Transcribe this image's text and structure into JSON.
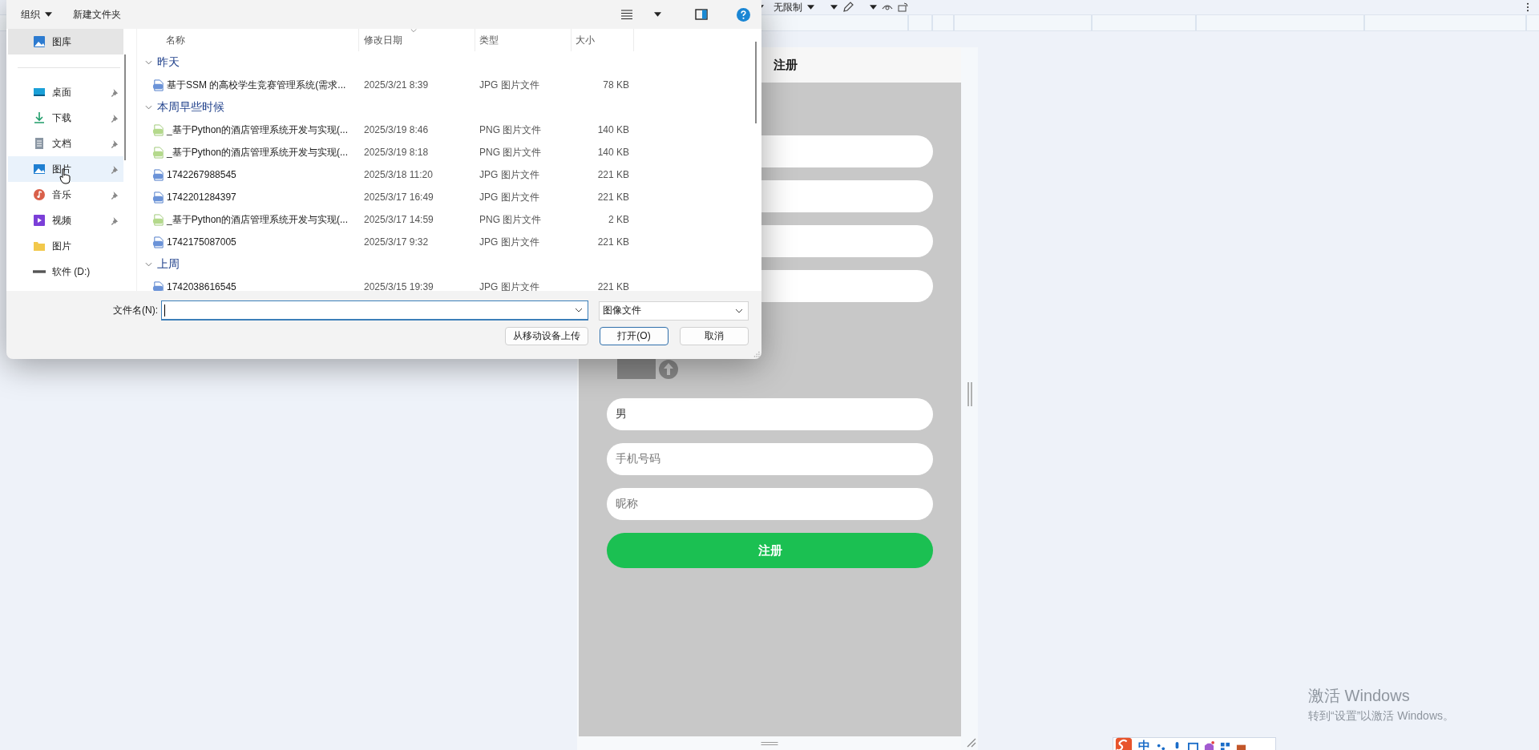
{
  "toolbar": {
    "zoom_label": "无限制"
  },
  "phone": {
    "title": "注册",
    "fields": [
      {
        "kind": "input"
      },
      {
        "kind": "input"
      },
      {
        "kind": "input"
      },
      {
        "kind": "input"
      },
      {
        "kind": "upload"
      },
      {
        "kind": "input",
        "value": "男"
      },
      {
        "kind": "input",
        "placeholder": "手机号码"
      },
      {
        "kind": "input",
        "placeholder": "昵称"
      }
    ],
    "submit_button": "注册"
  },
  "dialog": {
    "toolbar": {
      "organize": "组织",
      "new_folder": "新建文件夹"
    },
    "sidebar": [
      {
        "kind": "gallery",
        "label": "图库",
        "pinned": false,
        "selected": true,
        "hovered": false
      },
      {
        "kind": "desktop",
        "label": "桌面",
        "pinned": true,
        "selected": false,
        "hovered": false
      },
      {
        "kind": "download",
        "label": "下载",
        "pinned": true,
        "selected": false,
        "hovered": false
      },
      {
        "kind": "documents",
        "label": "文档",
        "pinned": true,
        "selected": false,
        "hovered": false
      },
      {
        "kind": "pictures",
        "label": "图片",
        "pinned": true,
        "selected": false,
        "hovered": true
      },
      {
        "kind": "music",
        "label": "音乐",
        "pinned": true,
        "selected": false,
        "hovered": false
      },
      {
        "kind": "video",
        "label": "视频",
        "pinned": true,
        "selected": false,
        "hovered": false
      },
      {
        "kind": "folder",
        "label": "图片",
        "pinned": false,
        "selected": false,
        "hovered": false
      },
      {
        "kind": "drive",
        "label": "软件 (D:)",
        "pinned": false,
        "selected": false,
        "hovered": false
      }
    ],
    "columns": [
      {
        "label": "名称",
        "sorted": false
      },
      {
        "label": "修改日期",
        "sorted": true
      },
      {
        "label": "类型",
        "sorted": false
      },
      {
        "label": "大小",
        "sorted": false
      }
    ],
    "groups": [
      {
        "label": "昨天",
        "expanded": true,
        "files": [
          {
            "kind": "jpg",
            "name": "基于SSM 的高校学生竞赛管理系统(需求...",
            "date": "2025/3/21 8:39",
            "type": "JPG 图片文件",
            "size": "78 KB"
          }
        ]
      },
      {
        "label": "本周早些时候",
        "expanded": true,
        "files": [
          {
            "kind": "png",
            "name": "_基于Python的酒店管理系统开发与实现(...",
            "date": "2025/3/19 8:46",
            "type": "PNG 图片文件",
            "size": "140 KB"
          },
          {
            "kind": "png",
            "name": "_基于Python的酒店管理系统开发与实现(...",
            "date": "2025/3/19 8:18",
            "type": "PNG 图片文件",
            "size": "140 KB"
          },
          {
            "kind": "jpg",
            "name": "1742267988545",
            "date": "2025/3/18 11:20",
            "type": "JPG 图片文件",
            "size": "221 KB"
          },
          {
            "kind": "jpg",
            "name": "1742201284397",
            "date": "2025/3/17 16:49",
            "type": "JPG 图片文件",
            "size": "221 KB"
          },
          {
            "kind": "png",
            "name": "_基于Python的酒店管理系统开发与实现(...",
            "date": "2025/3/17 14:59",
            "type": "PNG 图片文件",
            "size": "2 KB"
          },
          {
            "kind": "jpg",
            "name": "1742175087005",
            "date": "2025/3/17 9:32",
            "type": "JPG 图片文件",
            "size": "221 KB"
          }
        ]
      },
      {
        "label": "上周",
        "expanded": true,
        "files": [
          {
            "kind": "jpg",
            "name": "1742038616545",
            "date": "2025/3/15 19:39",
            "type": "JPG 图片文件",
            "size": "221 KB"
          }
        ]
      }
    ],
    "file_name": {
      "label": "文件名(N):"
    },
    "file_type": "图像文件",
    "buttons": [
      {
        "label": "从移动设备上传",
        "default": false
      },
      {
        "label": "打开(O)",
        "default": true
      },
      {
        "label": "取消",
        "default": false
      }
    ]
  },
  "activation_notice": {
    "title": "激活 Windows",
    "body": "转到“设置”以激活 Windows。"
  },
  "ime_bar": {
    "label": "中"
  }
}
